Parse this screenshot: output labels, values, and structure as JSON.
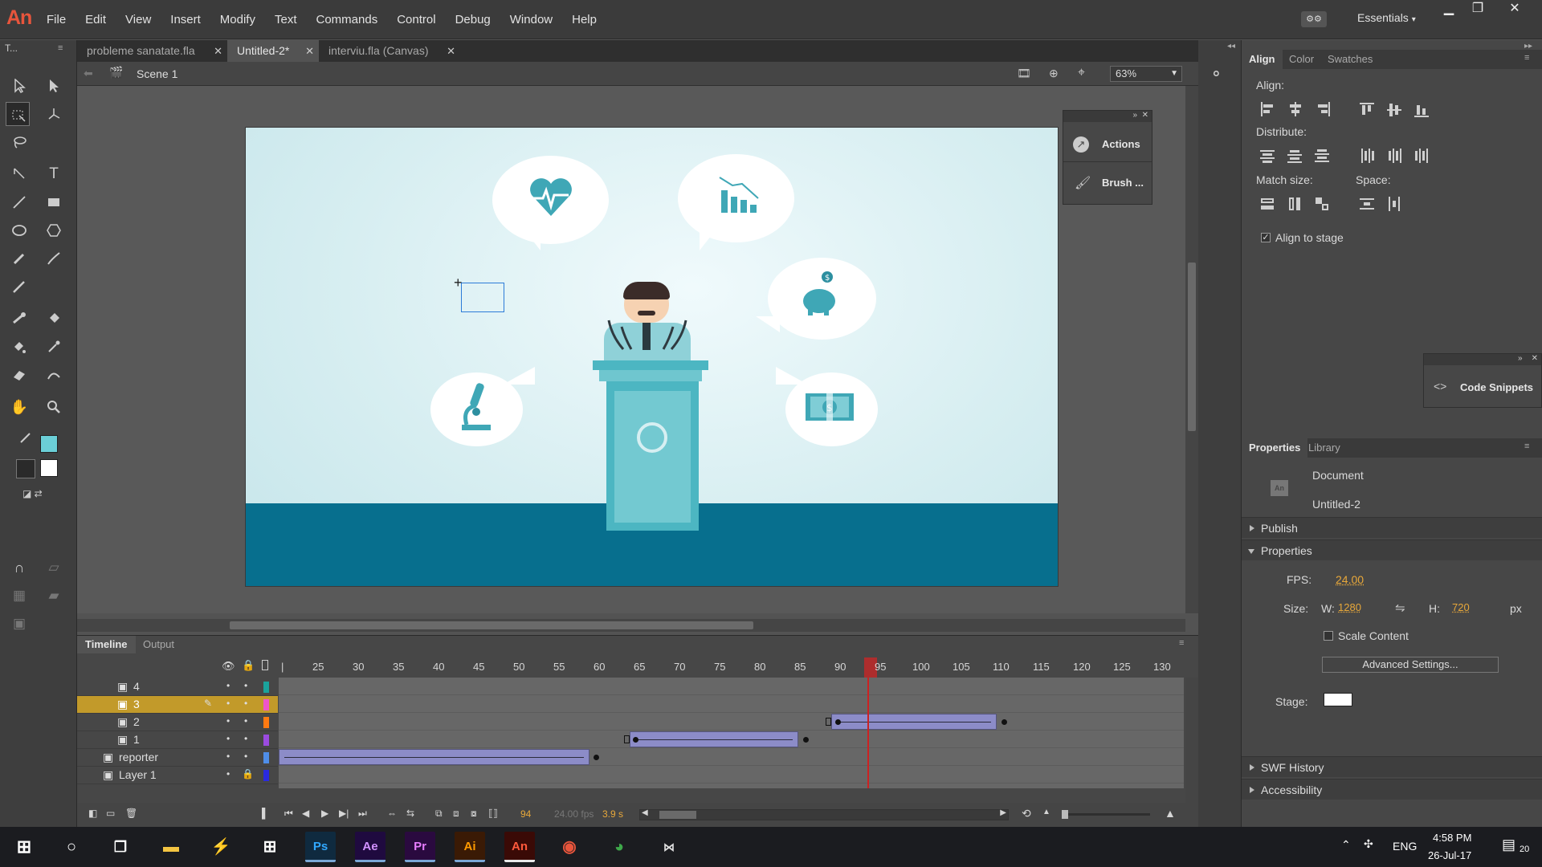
{
  "app": {
    "logo": "An",
    "workspace": "Essentials"
  },
  "menu": [
    "File",
    "Edit",
    "View",
    "Insert",
    "Modify",
    "Text",
    "Commands",
    "Control",
    "Debug",
    "Window",
    "Help"
  ],
  "tools_header": "T...",
  "doc_tabs": [
    {
      "label": "probleme sanatate.fla"
    },
    {
      "label": "Untitled-2*"
    },
    {
      "label": "interviu.fla (Canvas)"
    }
  ],
  "scene": {
    "label": "Scene 1",
    "zoom": "63%"
  },
  "float_panel": {
    "actions": "Actions",
    "brush": "Brush ..."
  },
  "code_snippets": "Code Snippets",
  "timeline": {
    "tabs": [
      "Timeline",
      "Output"
    ],
    "ruler": [
      "25",
      "30",
      "35",
      "40",
      "45",
      "50",
      "55",
      "60",
      "65",
      "70",
      "75",
      "80",
      "85",
      "90",
      "95",
      "100",
      "105",
      "110",
      "115",
      "120",
      "125",
      "130"
    ],
    "layers": [
      {
        "name": "4",
        "color": "#1aa39c"
      },
      {
        "name": "3",
        "color": "#ee55cc"
      },
      {
        "name": "2",
        "color": "#ff7a12"
      },
      {
        "name": "1",
        "color": "#9b4be0"
      },
      {
        "name": "reporter",
        "color": "#4f8ee8"
      },
      {
        "name": "Layer 1",
        "color": "#2a2ae0"
      }
    ],
    "current_frame": "94",
    "fps": "24.00 fps",
    "time": "3.9 s"
  },
  "align_panel": {
    "tabs": [
      "Align",
      "Color",
      "Swatches"
    ],
    "align_label": "Align:",
    "distribute_label": "Distribute:",
    "match_label": "Match size:",
    "space_label": "Space:",
    "align_to_stage": "Align to stage",
    "align_to_stage_checked": true
  },
  "properties": {
    "tabs": [
      "Properties",
      "Library"
    ],
    "type": "Document",
    "name": "Untitled-2",
    "publish": "Publish",
    "section": "Properties",
    "fps_label": "FPS:",
    "fps": "24.00",
    "size_label": "Size:",
    "w_label": "W:",
    "w": "1280",
    "h_label": "H:",
    "h": "720",
    "unit": "px",
    "scale_content": "Scale Content",
    "advanced": "Advanced Settings...",
    "stage_label": "Stage:",
    "swf_history": "SWF History",
    "accessibility": "Accessibility"
  },
  "taskbar": {
    "apps": [
      "Ps",
      "Ae",
      "Pr",
      "Ai",
      "An"
    ],
    "lang": "ENG",
    "time": "4:58 PM",
    "date": "26-Jul-17",
    "notifications": "20"
  },
  "colors": {
    "stage_floor": "#076f8e",
    "accent": "#c29a2a",
    "playhead": "#cc2222"
  }
}
